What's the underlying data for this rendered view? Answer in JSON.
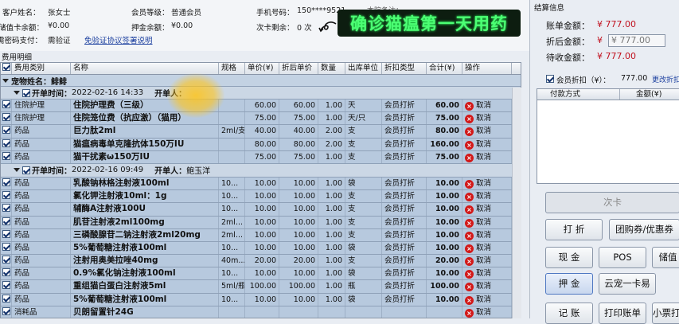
{
  "customer_info": {
    "name_label": "客户姓名：",
    "name_value": "张女士",
    "member_level_label": "会员等级：",
    "member_level_value": "普通会员",
    "phone_label": "手机号码：",
    "phone_value": "150****9521",
    "remark_label": "本院备注：",
    "stored_card_label": "储值卡余额：",
    "stored_card_value": "¥0.00",
    "deposit_label": "押金余额：",
    "deposit_value": "¥0.00",
    "times_card_label": "次卡剩余：",
    "times_card_value": "0 次",
    "password_label": "需密码支付：",
    "password_value": "需验证",
    "protocol_link": "免验证协议签署说明"
  },
  "banner_text": "确诊猫瘟第一天用药",
  "detail_title": "费用明细",
  "columns": [
    "费用类别",
    "名称",
    "规格",
    "单价(¥)",
    "折后单价",
    "数量",
    "出库单位",
    "折扣类型",
    "合计(¥)",
    "操作"
  ],
  "pet_group": {
    "label": "宠物姓名：",
    "value": "鲱鲱"
  },
  "orders": [
    {
      "time_label": "开单时间：",
      "time_value": "2022-02-16 14:33",
      "person_label": "开单人：",
      "person_value": "",
      "items": [
        {
          "category": "住院护理",
          "name": "住院护理费（三级）",
          "spec": "",
          "price": "60.00",
          "discount_price": "60.00",
          "qty": "1.00",
          "unit": "天",
          "discount_type": "会员打折",
          "total": "60.00",
          "action": "取消"
        },
        {
          "category": "住院护理",
          "name": "住院笼位费（抗应激）（猫用）",
          "spec": "",
          "price": "75.00",
          "discount_price": "75.00",
          "qty": "1.00",
          "unit": "天/只",
          "discount_type": "会员打折",
          "total": "75.00",
          "action": "取消"
        },
        {
          "category": "药品",
          "name": "巨力肽2ml",
          "spec": "2ml/支",
          "price": "40.00",
          "discount_price": "40.00",
          "qty": "2.00",
          "unit": "支",
          "discount_type": "会员打折",
          "total": "80.00",
          "action": "取消"
        },
        {
          "category": "药品",
          "name": "猫瘟病毒单克隆抗体150万IU",
          "spec": "",
          "price": "80.00",
          "discount_price": "80.00",
          "qty": "2.00",
          "unit": "支",
          "discount_type": "会员打折",
          "total": "160.00",
          "action": "取消"
        },
        {
          "category": "药品",
          "name": "猫干扰素ω150万IU",
          "spec": "",
          "price": "75.00",
          "discount_price": "75.00",
          "qty": "1.00",
          "unit": "支",
          "discount_type": "会员打折",
          "total": "75.00",
          "action": "取消"
        }
      ]
    },
    {
      "time_label": "开单时间：",
      "time_value": "2022-02-16 09:49",
      "person_label": "开单人：",
      "person_value": "鲍玉洋",
      "items": [
        {
          "category": "药品",
          "name": "乳酸钠林格注射液100ml",
          "spec": "10...",
          "price": "10.00",
          "discount_price": "10.00",
          "qty": "1.00",
          "unit": "袋",
          "discount_type": "会员打折",
          "total": "10.00",
          "action": "取消"
        },
        {
          "category": "药品",
          "name": "氯化钾注射液10ml：1g",
          "spec": "10...",
          "price": "10.00",
          "discount_price": "10.00",
          "qty": "1.00",
          "unit": "支",
          "discount_type": "会员打折",
          "total": "10.00",
          "action": "取消"
        },
        {
          "category": "药品",
          "name": "辅酶A注射液100U",
          "spec": "10...",
          "price": "10.00",
          "discount_price": "10.00",
          "qty": "1.00",
          "unit": "支",
          "discount_type": "会员打折",
          "total": "10.00",
          "action": "取消"
        },
        {
          "category": "药品",
          "name": "肌苷注射液2ml100mg",
          "spec": "2ml...",
          "price": "10.00",
          "discount_price": "10.00",
          "qty": "1.00",
          "unit": "支",
          "discount_type": "会员打折",
          "total": "10.00",
          "action": "取消"
        },
        {
          "category": "药品",
          "name": "三磷酸腺苷二钠注射液2ml20mg",
          "spec": "2ml...",
          "price": "10.00",
          "discount_price": "10.00",
          "qty": "1.00",
          "unit": "支",
          "discount_type": "会员打折",
          "total": "10.00",
          "action": "取消"
        },
        {
          "category": "药品",
          "name": "5%葡萄糖注射液100ml",
          "spec": "10...",
          "price": "10.00",
          "discount_price": "10.00",
          "qty": "1.00",
          "unit": "袋",
          "discount_type": "会员打折",
          "total": "10.00",
          "action": "取消"
        },
        {
          "category": "药品",
          "name": "注射用奥美拉唑40mg",
          "spec": "40m...",
          "price": "20.00",
          "discount_price": "20.00",
          "qty": "1.00",
          "unit": "支",
          "discount_type": "会员打折",
          "total": "20.00",
          "action": "取消"
        },
        {
          "category": "药品",
          "name": "0.9%氯化钠注射液100ml",
          "spec": "10...",
          "price": "10.00",
          "discount_price": "10.00",
          "qty": "1.00",
          "unit": "袋",
          "discount_type": "会员打折",
          "total": "10.00",
          "action": "取消"
        },
        {
          "category": "药品",
          "name": "重组猫白蛋白注射液5ml",
          "spec": "5ml/瓶",
          "price": "100.00",
          "discount_price": "100.00",
          "qty": "1.00",
          "unit": "瓶",
          "discount_type": "会员打折",
          "total": "100.00",
          "action": "取消"
        },
        {
          "category": "药品",
          "name": "5%葡萄糖注射液100ml",
          "spec": "10...",
          "price": "10.00",
          "discount_price": "10.00",
          "qty": "1.00",
          "unit": "袋",
          "discount_type": "会员打折",
          "total": "10.00",
          "action": "取消"
        },
        {
          "category": "消耗品",
          "name": "贝朗留置针24G",
          "spec": "",
          "price": "",
          "discount_price": "",
          "qty": "",
          "unit": "",
          "discount_type": "",
          "total": "",
          "action": "取消"
        }
      ]
    }
  ],
  "settlement": {
    "title": "结算信息",
    "bill_label": "账单金额：",
    "bill_value": "¥ 777.00",
    "discount_label": "折后金额：",
    "discount_value": "¥ 777.00",
    "receivable_label": "待收金额：",
    "receivable_value": "¥ 777.00",
    "member_discount_label": "会员折扣（¥）：",
    "member_discount_value": "777.00",
    "change_discount_link": "更改折扣",
    "pay_columns": [
      "付款方式",
      "金额(¥)"
    ]
  },
  "buttons": {
    "times_card": "次卡",
    "discount": "打 折",
    "group_coupon": "团购券/优惠券",
    "cash": "现 金",
    "pos": "POS",
    "stored": "储值",
    "deposit": "押 金",
    "cloud_pet": "云宠一卡易",
    "credit": "记 账",
    "print_bill": "打印账单",
    "small_ticket": "小票打印"
  },
  "colors": {
    "row_bg": "#b7c9de",
    "amount_red": "#c1121f",
    "banner_text": "#4cff74"
  }
}
